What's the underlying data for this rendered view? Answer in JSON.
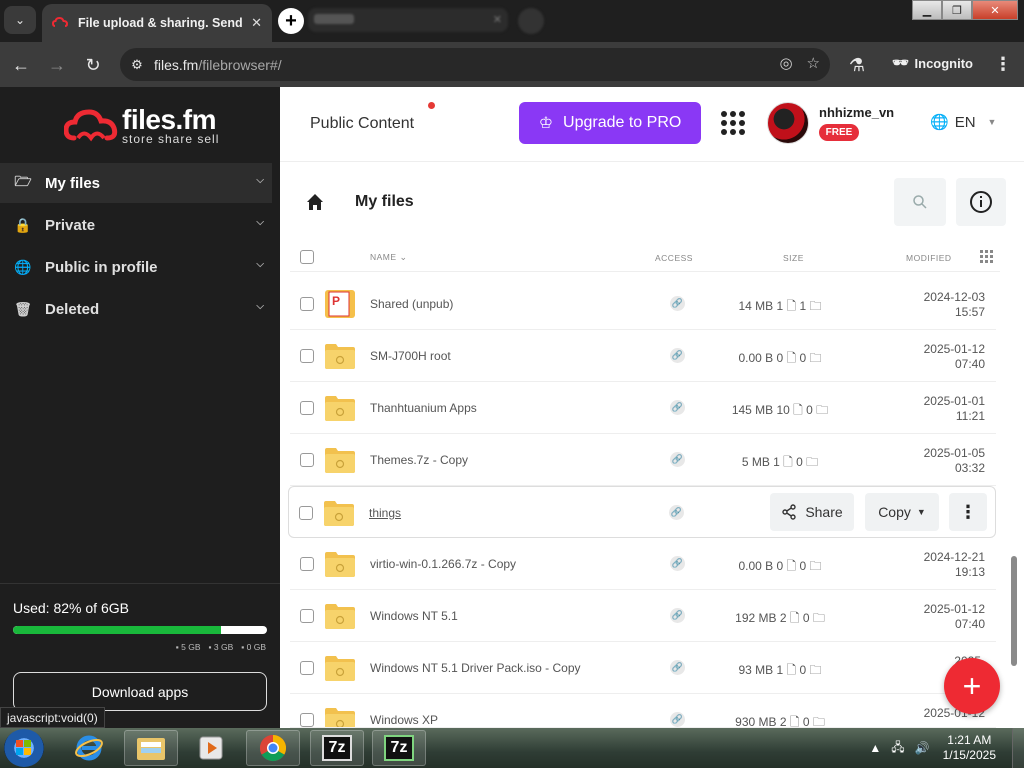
{
  "browser": {
    "tab_title": "File upload & sharing. Send large files",
    "tab_close": "✕",
    "url_host": "files.fm",
    "url_path": "/filebrowser#/",
    "incognito_label": "Incognito"
  },
  "sidebar": {
    "brand": "files.fm",
    "tagline": "store share sell",
    "items": [
      {
        "label": "My files",
        "icon": "folder-open-icon"
      },
      {
        "label": "Private",
        "icon": "lock-icon"
      },
      {
        "label": "Public in profile",
        "icon": "globe-icon"
      },
      {
        "label": "Deleted",
        "icon": "trash-icon"
      }
    ],
    "used_label": "Used: 82% of 6GB",
    "used_fraction": 0.82,
    "legend": [
      "5 GB",
      "3 GB",
      "0 GB"
    ],
    "download_label": "Download apps"
  },
  "status_tip": "javascript:void(0)",
  "header": {
    "public_content": "Public Content",
    "upgrade_label": "Upgrade to PRO",
    "username": "nhhizme_vn",
    "plan_badge": "FREE",
    "language": "EN"
  },
  "files": {
    "title": "My files",
    "columns": {
      "name": "NAME",
      "access": "ACCESS",
      "size": "SIZE",
      "modified": "MODIFIED"
    },
    "rows": [
      {
        "name": "Shared (unpub)",
        "size": "14 MB 1 🗋 1 🗀",
        "date": "2024-12-03",
        "time": "15:57",
        "icon": "pages-folder-icon"
      },
      {
        "name": "SM-J700H root",
        "size": "0.00  B 0 🗋 0 🗀",
        "date": "2025-01-12",
        "time": "07:40",
        "icon": "folder-icon"
      },
      {
        "name": "Thanhtuanium Apps",
        "size": "145 MB 10 🗋 0 🗀",
        "date": "2025-01-01",
        "time": "11:21",
        "icon": "folder-icon"
      },
      {
        "name": "Themes.7z - Copy",
        "size": "5 MB 1 🗋 0 🗀",
        "date": "2025-01-05",
        "time": "03:32",
        "icon": "folder-icon"
      },
      {
        "name": "things",
        "size": "",
        "date": "",
        "time": "",
        "icon": "folder-icon"
      },
      {
        "name": "virtio-win-0.1.266.7z - Copy",
        "size": "0.00  B 0 🗋 0 🗀",
        "date": "2024-12-21",
        "time": "19:13",
        "icon": "folder-icon"
      },
      {
        "name": "Windows NT 5.1",
        "size": "192 MB 2 🗋 0 🗀",
        "date": "2025-01-12",
        "time": "07:40",
        "icon": "folder-icon"
      },
      {
        "name": "Windows NT 5.1 Driver Pack.iso - Copy",
        "size": "93 MB 1 🗋 0 🗀",
        "date": "2025-",
        "time": "",
        "icon": "folder-icon"
      },
      {
        "name": "Windows XP",
        "size": "930 MB 2 🗋 0 🗀",
        "date": "2025-01-12",
        "time": "",
        "icon": "folder-icon"
      }
    ],
    "hover_actions": {
      "share": "Share",
      "copy": "Copy"
    }
  },
  "taskbar": {
    "time": "1:21 AM",
    "date": "1/15/2025",
    "sevenzip_label": "7z"
  },
  "colors": {
    "accent": "#8a38f5",
    "brand_red": "#ee2a33",
    "storage_green": "#19b83b"
  }
}
